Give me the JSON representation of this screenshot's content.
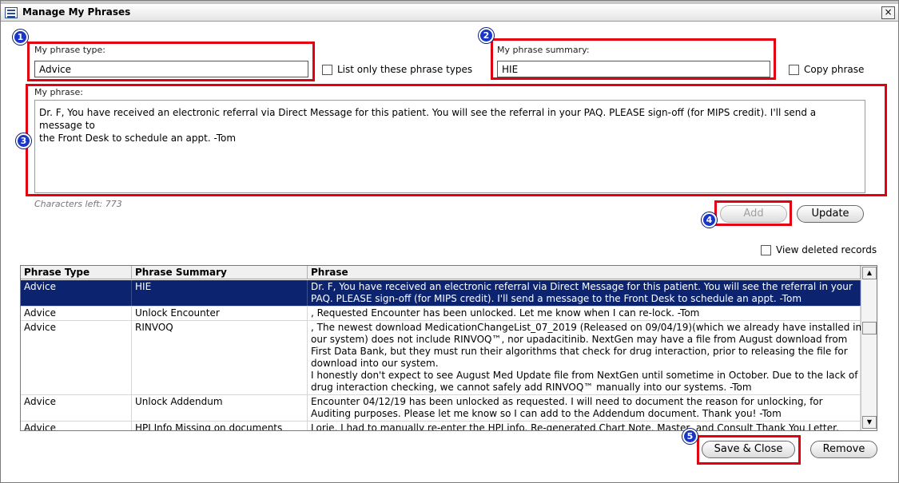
{
  "window": {
    "title": "Manage My Phrases",
    "close_label": "×"
  },
  "form": {
    "phrase_type_label": "My phrase type:",
    "phrase_type_value": "Advice",
    "list_only_label": "List only these phrase types",
    "phrase_summary_label": "My phrase summary:",
    "phrase_summary_value": "HIE",
    "copy_phrase_label": "Copy phrase",
    "phrase_label": "My phrase:",
    "phrase_text_line1": "Dr. F,  You have received an electronic referral via Direct Message for this patient.  You will see the referral in your PAQ.  PLEASE sign-off (for MIPS credit).  I'll send a message to",
    "phrase_text_line2": "the Front Desk to schedule an appt.  -Tom",
    "characters_left": "Characters left: 773"
  },
  "buttons": {
    "add": "Add",
    "update": "Update",
    "save_close": "Save & Close",
    "remove": "Remove"
  },
  "view_deleted_label": "View deleted records",
  "callouts": [
    "1",
    "2",
    "3",
    "4",
    "5"
  ],
  "table": {
    "headers": [
      "Phrase Type",
      "Phrase Summary",
      "Phrase"
    ],
    "rows": [
      {
        "type": "Advice",
        "summary": "HIE",
        "phrase": [
          "Dr. F,  You have received an electronic referral via Direct Message for this patient.  You will see the referral in your",
          "PAQ.  PLEASE sign-off (for MIPS credit).  I'll send a message to the Front Desk to schedule an appt.  -Tom"
        ],
        "selected": true
      },
      {
        "type": "Advice",
        "summary": "Unlock Encounter",
        "phrase": [
          ", Requested Encounter has been unlocked.  Let me know when I can re-lock.  -Tom"
        ],
        "selected": false
      },
      {
        "type": "Advice",
        "summary": "RINVOQ",
        "phrase": [
          ", The newest download MedicationChangeList_07_2019 (Released on 09/04/19)(which we already have installed in",
          "our system) does not include RINVOQ™, nor upadacitinib.  NextGen may have a file from August download from",
          "First Data Bank, but they must run their algorithms that check for drug interaction, prior to releasing the file for",
          "download into our system.",
          "I honestly don't expect to see August Med Update file from NextGen until sometime in October.   Due to the lack of",
          "drug interaction checking, we cannot safely add RINVOQ™ manually into our systems.  -Tom"
        ],
        "selected": false
      },
      {
        "type": "Advice",
        "summary": "Unlock Addendum",
        "phrase": [
          "Encounter 04/12/19 has been unlocked as requested.  I will need to document the reason for unlocking, for",
          "Auditing purposes.  Please let me know so I can add to the Addendum document.  Thank you!  -Tom"
        ],
        "selected": false
      },
      {
        "type": "Advice",
        "summary": "HPI Info Missing on documents",
        "phrase": [
          "Lorie,  I had to manually re-enter the HPI info.  Re-generated Chart Note, Master, and Consult Thank You Letter."
        ],
        "selected": false
      }
    ]
  },
  "colors": {
    "callout_red": "#e3000f",
    "badge_blue": "#1a36c8",
    "selected_row": "#0c2470"
  },
  "icons": {
    "window_icon": "list-window-icon",
    "close": "close-icon",
    "scroll_up": "scroll-up-arrow-icon",
    "scroll_down": "scroll-down-arrow-icon"
  }
}
